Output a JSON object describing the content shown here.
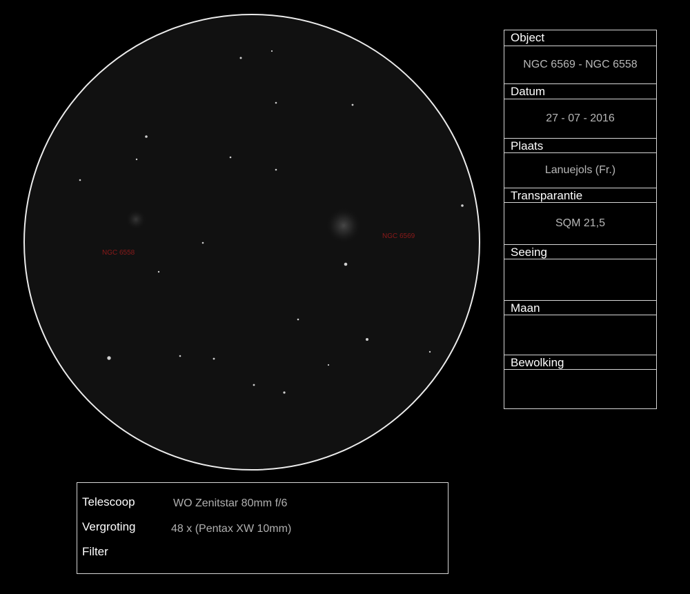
{
  "sketch": {
    "colors": {
      "background": "#000000",
      "field": "#111111",
      "ring": "#e8e8e8",
      "label": "#8b1a1a"
    },
    "labels": {
      "ngc6558": "NGC 6558",
      "ngc6569": "NGC 6569"
    }
  },
  "panel": {
    "object": {
      "label": "Object",
      "value": "NGC 6569 - NGC 6558"
    },
    "datum": {
      "label": "Datum",
      "value": "27 - 07 - 2016"
    },
    "plaats": {
      "label": "Plaats",
      "value": "Lanuejols (Fr.)"
    },
    "transparantie": {
      "label": "Transparantie",
      "value": "SQM 21,5"
    },
    "seeing": {
      "label": "Seeing",
      "value": ""
    },
    "maan": {
      "label": "Maan",
      "value": ""
    },
    "bewolking": {
      "label": "Bewolking",
      "value": ""
    }
  },
  "equipment": {
    "telescoop": {
      "label": "Telescoop",
      "value": "WO Zenitstar 80mm f/6"
    },
    "vergroting": {
      "label": "Vergroting",
      "value": "48 x (Pentax XW 10mm)"
    },
    "filter": {
      "label": "Filter",
      "value": ""
    }
  }
}
